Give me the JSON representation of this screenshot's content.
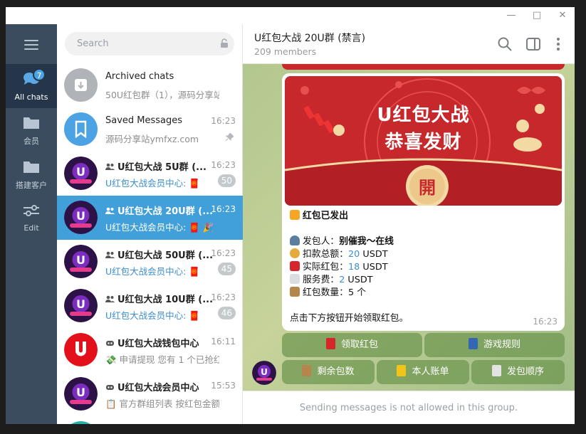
{
  "sidebar": {
    "badge": "7",
    "items": [
      {
        "label": "All chats"
      },
      {
        "label": "会员"
      },
      {
        "label": "搭建客户"
      },
      {
        "label": "Edit"
      }
    ]
  },
  "search": {
    "placeholder": "Search"
  },
  "chats": [
    {
      "title": "Archived chats",
      "time": "",
      "preview": "50U红包群（1），源码分享站...",
      "count": ""
    },
    {
      "title": "Saved Messages",
      "time": "16:23",
      "preview": "源码分享站ymfxz.com",
      "count": ""
    },
    {
      "title": "U红包大战 5U群 (...",
      "time": "16:23",
      "preview": "U红包大战会员中心: 🧧",
      "count": "50"
    },
    {
      "title": "U红包大战 20U群 (...",
      "time": "16:23",
      "preview": "U红包大战会员中心: 🧧 🎉",
      "count": ""
    },
    {
      "title": "U红包大战 50U群 (...",
      "time": "16:23",
      "preview": "U红包大战会员中心: 🧧",
      "count": "45"
    },
    {
      "title": "U红包大战 10U群 (...",
      "time": "16:23",
      "preview": "U红包大战会员中心: 🧧",
      "count": "46"
    },
    {
      "title": "U红包大战钱包中心",
      "time": "16:11",
      "preview": "💸 申请提现 您有 1 个已抢红...",
      "count": ""
    },
    {
      "title": "U红包大战会员中心",
      "time": "15:53",
      "preview": "📋 官方群组列表 按红包金额...",
      "count": ""
    }
  ],
  "header": {
    "title": "U红包大战 20U群 (禁言)",
    "subtitle": "209 members"
  },
  "banner": {
    "line1": "U红包大战",
    "line2": "恭喜发财",
    "seal": "開"
  },
  "message": {
    "headline": "红包已发出",
    "sender_label": "发包人：",
    "sender_value": "别催我～在线",
    "amount_label": "扣款总额：",
    "amount_num": "20",
    "amount_unit": " USDT",
    "actual_label": "实际红包：",
    "actual_num": "18",
    "actual_unit": " USDT",
    "fee_label": "服务费：",
    "fee_num": "2",
    "fee_unit": " USDT",
    "qty_label": "红包数量：",
    "qty_value": "5 个",
    "cta": "点击下方按钮开始领取红包。",
    "time": "16:23"
  },
  "buttons": {
    "claim": "领取红包",
    "rules": "游戏规则",
    "remaining": "剩余包数",
    "account": "本人账单",
    "order": "发包顺序"
  },
  "footer": {
    "notice": "Sending messages is not allowed in this group."
  },
  "colors": {
    "accent": "#419fd9",
    "rail": "#3a4c5e",
    "rail_active": "#25364a",
    "red": "#c6282c",
    "gold": "#f3d9a4"
  }
}
